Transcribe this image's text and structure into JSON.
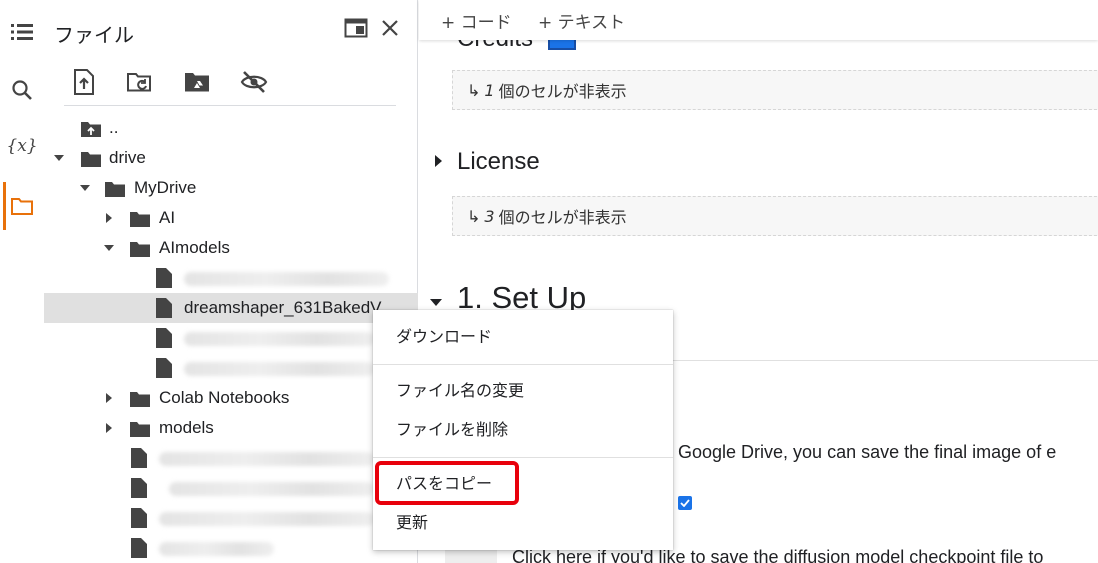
{
  "rail": {
    "icons": [
      "toc-icon",
      "search-icon",
      "variables-icon",
      "folder-icon"
    ],
    "variables_glyph": "{x}",
    "accent": "#e8710a"
  },
  "panel": {
    "title": "ファイル",
    "toolbar": [
      "upload-icon",
      "refresh-folder-icon",
      "drive-icon",
      "hide-files-icon"
    ],
    "tree": [
      {
        "label": "..",
        "type": "parent"
      },
      {
        "label": "drive",
        "type": "folder",
        "expanded": true
      },
      {
        "label": "MyDrive",
        "type": "folder",
        "expanded": true
      },
      {
        "label": "AI",
        "type": "folder",
        "expanded": false
      },
      {
        "label": "AImodels",
        "type": "folder",
        "expanded": true
      },
      {
        "label": "",
        "type": "file",
        "blurred": true
      },
      {
        "label": "dreamshaper_631BakedV",
        "type": "file",
        "selected": true
      },
      {
        "label": "",
        "type": "file",
        "blurred": true
      },
      {
        "label": "",
        "type": "file",
        "blurred": true
      },
      {
        "label": "Colab Notebooks",
        "type": "folder",
        "expanded": false
      },
      {
        "label": "models",
        "type": "folder",
        "expanded": false
      },
      {
        "label": "",
        "type": "file",
        "blurred": true
      },
      {
        "label": "",
        "type": "file",
        "blurred": true
      },
      {
        "label": "",
        "type": "file",
        "blurred": true
      },
      {
        "label": "",
        "type": "file",
        "blurred": true
      }
    ]
  },
  "notebook": {
    "add_code": "+ コード",
    "add_text": "+ テキスト",
    "credits_heading": "Credits",
    "hidden1": {
      "prefix": "↳",
      "count": "1",
      "suffix": "個のセルが非表示"
    },
    "license_heading": "License",
    "hidden2": {
      "prefix": "↳",
      "count": "3",
      "suffix": "個のセルが非表示"
    },
    "setup_heading": "1. Set Up",
    "drive_text": "r Google Drive, you can save the final image of e",
    "click_text": "Click here if you'd like to save the diffusion model checkpoint file to"
  },
  "context_menu": {
    "items": [
      "ダウンロード",
      "ファイル名の変更",
      "ファイルを削除",
      "パスをコピー",
      "更新"
    ],
    "highlight_color": "#e8000b"
  }
}
